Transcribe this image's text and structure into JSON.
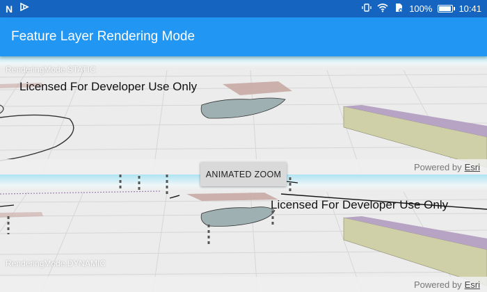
{
  "status_bar": {
    "left_icons": [
      "n-notification-icon",
      "relay-notification-icon"
    ],
    "right_icons": [
      "vibrate-icon",
      "wifi-icon",
      "sim-off-icon",
      "battery-icon"
    ],
    "battery_percent": "100%",
    "battery_level": 1.0,
    "time": "10:41"
  },
  "app_bar": {
    "title": "Feature Layer Rendering Mode"
  },
  "scene_static": {
    "mode_label": "RenderingMode.STATIC",
    "license_text": "Licensed For Developer Use Only",
    "attribution_prefix": "Powered by",
    "attribution_link": "Esri"
  },
  "scene_dynamic": {
    "mode_label": "RenderingMode.DYNAMIC",
    "license_text": "Licensed For Developer Use Only",
    "attribution_prefix": "Powered by",
    "attribution_link": "Esri"
  },
  "zoom_button": {
    "label": "ANIMATED ZOOM"
  },
  "colors": {
    "status_bar": "#1565c0",
    "app_bar": "#2196f3",
    "ground": "#ececec",
    "building_olive": "#cfcfa8",
    "building_purple": "#b7a3c3",
    "building_brown": "#c9aaa5",
    "water": "#9fb0b2"
  }
}
